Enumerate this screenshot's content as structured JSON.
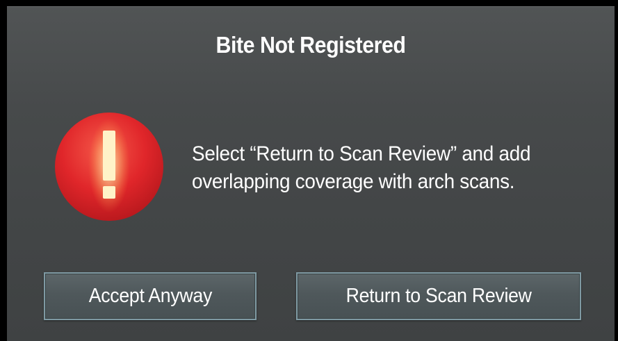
{
  "dialog": {
    "title": "Bite Not Registered",
    "icon": "exclamation-alert-icon",
    "message_lines": [
      "Select “Return to Scan Review” and add",
      "overlapping coverage with arch scans."
    ],
    "buttons": {
      "accept_label": "Accept Anyway",
      "return_label": "Return to Scan Review"
    }
  },
  "colors": {
    "alert_red": "#e0262a",
    "alert_mark": "#ffe9a8",
    "button_border": "#7f9aa3",
    "dialog_bg": "#474a4b"
  }
}
